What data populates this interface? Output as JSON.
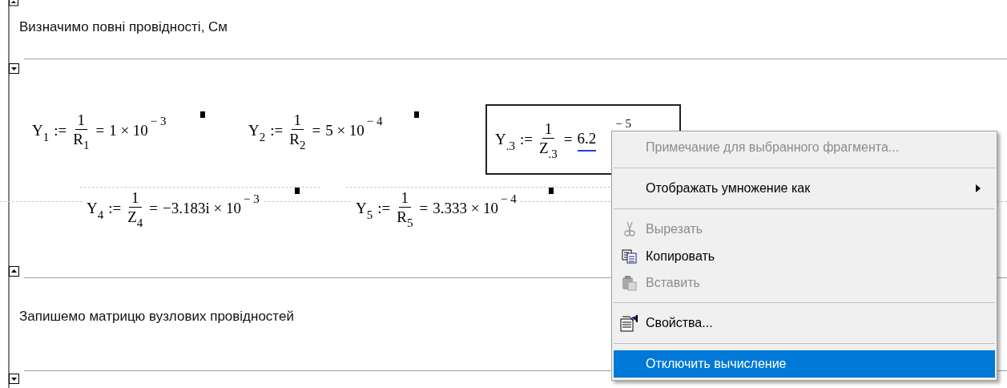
{
  "texts": [
    {
      "text": "Визначимо повні провідності, См"
    },
    {
      "text": "Запишемо матрицю вузлових провідностей"
    }
  ],
  "equations": [
    {
      "name": "Y",
      "sub": "1",
      "assign": ":=",
      "num": "1",
      "den": "R",
      "den_sub": "1",
      "equals": "=",
      "result": "1 × 10",
      "exp": "− 3",
      "selected": false
    },
    {
      "name": "Y",
      "sub": "2",
      "assign": ":=",
      "num": "1",
      "den": "R",
      "den_sub": "2",
      "equals": "=",
      "result": "5 × 10",
      "exp": "− 4",
      "selected": false
    },
    {
      "name": "Y",
      "sub": ".3",
      "assign": ":=",
      "num": "1",
      "den": "Z",
      "den_sub": ".3",
      "equals": "=",
      "result": "6.2",
      "exp": "− 5",
      "selected": true
    },
    {
      "name": "Y",
      "sub": "4",
      "assign": ":=",
      "num": "1",
      "den": "Z",
      "den_sub": "4",
      "equals": "=",
      "result": "−3.183i × 10",
      "exp": "− 3",
      "selected": false
    },
    {
      "name": "Y",
      "sub": "5",
      "assign": ":=",
      "num": "1",
      "den": "R",
      "den_sub": "5",
      "equals": "=",
      "result": "3.333 × 10",
      "exp": "− 4",
      "selected": false
    }
  ],
  "context_menu": {
    "items": [
      {
        "kind": "item",
        "label": "Примечание для выбранного фрагмента...",
        "disabled": true,
        "submenu": false,
        "selected": false
      },
      {
        "kind": "separator"
      },
      {
        "kind": "item",
        "label": "Отображать умножение как",
        "disabled": false,
        "submenu": true,
        "selected": false
      },
      {
        "kind": "separator"
      },
      {
        "kind": "item",
        "label": "Вырезать",
        "disabled": true,
        "submenu": false,
        "selected": false
      },
      {
        "kind": "item",
        "label": "Копировать",
        "disabled": false,
        "submenu": false,
        "selected": false
      },
      {
        "kind": "item",
        "label": "Вставить",
        "disabled": true,
        "submenu": false,
        "selected": false
      },
      {
        "kind": "separator"
      },
      {
        "kind": "item",
        "label": "Свойства...",
        "disabled": false,
        "submenu": false,
        "selected": false
      },
      {
        "kind": "separator"
      },
      {
        "kind": "item",
        "label": "Отключить вычисление",
        "disabled": false,
        "submenu": false,
        "selected": true
      }
    ]
  }
}
